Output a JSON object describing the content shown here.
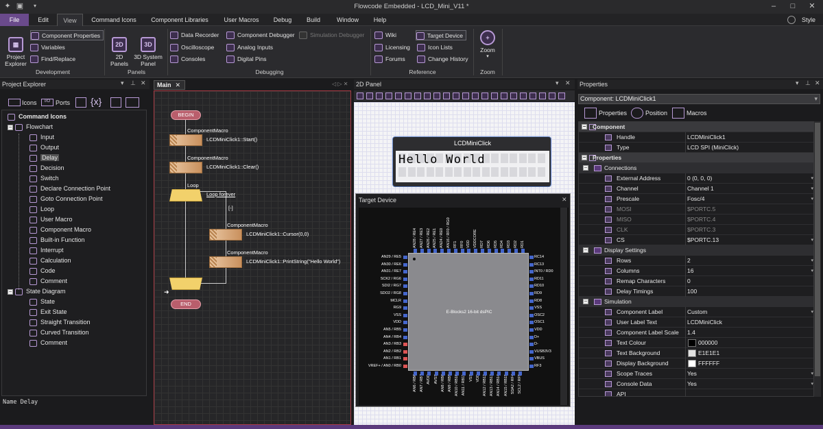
{
  "window": {
    "title": "Flowcode Embedded - LCD_Mini_V11 *",
    "style_label": "Style"
  },
  "menu": {
    "file": "File",
    "edit": "Edit",
    "view": "View",
    "command_icons": "Command Icons",
    "component_libraries": "Component Libraries",
    "user_macros": "User Macros",
    "debug": "Debug",
    "build": "Build",
    "window": "Window",
    "help": "Help"
  },
  "ribbon": {
    "project_explorer": "Project\nExplorer",
    "component_properties": "Component Properties",
    "variables": "Variables",
    "find_replace": "Find/Replace",
    "group_development": "Development",
    "panels_2d": "2D\nPanels",
    "system_panel_3d": "3D System\nPanel",
    "group_panels": "Panels",
    "data_recorder": "Data Recorder",
    "oscilloscope": "Oscilloscope",
    "consoles": "Consoles",
    "component_debugger": "Component Debugger",
    "analog_inputs": "Analog Inputs",
    "digital_pins": "Digital Pins",
    "simulation_debugger": "Simulation Debugger",
    "group_debugging": "Debugging",
    "wiki": "Wiki",
    "licensing": "Licensing",
    "forums": "Forums",
    "target_device": "Target Device",
    "icon_lists": "Icon Lists",
    "change_history": "Change History",
    "group_reference": "Reference",
    "zoom": "Zoom",
    "group_zoom": "Zoom"
  },
  "project_explorer": {
    "title": "Project Explorer",
    "tab_icons": "Icons",
    "tab_ports": "Ports",
    "status": "Name Delay",
    "items": [
      {
        "label": "Command Icons",
        "bold": true,
        "level": 0
      },
      {
        "label": "Flowchart",
        "level": 1,
        "exp": true
      },
      {
        "label": "Input",
        "level": 2
      },
      {
        "label": "Output",
        "level": 2
      },
      {
        "label": "Delay",
        "level": 2,
        "sel": true
      },
      {
        "label": "Decision",
        "level": 2
      },
      {
        "label": "Switch",
        "level": 2
      },
      {
        "label": "Declare Connection Point",
        "level": 2
      },
      {
        "label": "Goto Connection Point",
        "level": 2
      },
      {
        "label": "Loop",
        "level": 2
      },
      {
        "label": "User Macro",
        "level": 2
      },
      {
        "label": "Component Macro",
        "level": 2
      },
      {
        "label": "Built-in Function",
        "level": 2
      },
      {
        "label": "Interrupt",
        "level": 2
      },
      {
        "label": "Calculation",
        "level": 2
      },
      {
        "label": "Code",
        "level": 2
      },
      {
        "label": "Comment",
        "level": 2
      },
      {
        "label": "State Diagram",
        "level": 1,
        "exp": true
      },
      {
        "label": "State",
        "level": 2
      },
      {
        "label": "Exit State",
        "level": 2
      },
      {
        "label": "Straight Transition",
        "level": 2
      },
      {
        "label": "Curved Transition",
        "level": 2
      },
      {
        "label": "Comment",
        "level": 2
      }
    ]
  },
  "main": {
    "tab": "Main",
    "begin": "BEGIN",
    "end": "END",
    "loop_label": "Loop",
    "loop_text": "Loop forever",
    "collapse": "[-]",
    "macros": [
      {
        "head": "ComponentMacro",
        "call": "LCDMiniClick1::Start()"
      },
      {
        "head": "ComponentMacro",
        "call": "LCDMiniClick1::Clear()"
      },
      {
        "head": "ComponentMacro",
        "call": "LCDMiniClick1::Cursor(0,0)"
      },
      {
        "head": "ComponentMacro",
        "call": "LCDMiniClick1::PrintString(\"Hello World\")"
      }
    ]
  },
  "panel2d": {
    "title": "2D Panel",
    "lcd_title": "LCDMiniClick",
    "lcd_text": "Hello World"
  },
  "target": {
    "title": "Target Device",
    "chip_label": "E-Blocks2 16-bit dsPIC",
    "left_pins": [
      "AN29 / RE5",
      "AN30 / RE6",
      "AN31 / RE7",
      "SCK2 / RG6",
      "SDI2 / RG7",
      "SDO2 / RG8",
      "MCLR",
      "RG9",
      "VSS",
      "VDD",
      "AN5 / RB5",
      "AN4 / RB4",
      "AN3 / RB3",
      "AN2 / RB2",
      "AN1 / RB1",
      "VREF+ / AN0 / RB0"
    ],
    "right_pins": [
      "RC14",
      "RC13",
      "INT0 / RD0",
      "RD11",
      "RD10",
      "RD9",
      "RD8",
      "VSS",
      "OSC2",
      "OSC1",
      "VDD",
      "D+",
      "D-",
      "VUSB3V3",
      "VBUS",
      "RF3"
    ],
    "top_pins": [
      "AN28 / RE4",
      "AN27 / RE3",
      "AN26 / RE2",
      "AN25 / RE1",
      "AN24 / RE0",
      "AN16 / RF0 / RG0",
      "RF1",
      "RF0",
      "VDD",
      "VDDCORE",
      "RD7",
      "RD6",
      "RD5",
      "RD4",
      "RD3",
      "RD2",
      "RD1"
    ],
    "bottom_pins": [
      "AN6 / RB6",
      "AN7 / RB7",
      "AVDD",
      "AVSS",
      "AN8 / RB8",
      "AN9 / RB9",
      "AN10 / RB10",
      "AN11 / RB11",
      "VSS",
      "VDD",
      "AN12 / RB12",
      "AN13 / RB13",
      "AN14 / RB14",
      "AN15 / RB15",
      "SDA2 / RF4",
      "SCL2 / RF5"
    ]
  },
  "properties": {
    "title": "Properties",
    "component": "Component: LCDMiniClick1",
    "tab_properties": "Properties",
    "tab_position": "Position",
    "tab_macros": "Macros",
    "rows": [
      {
        "type": "cat",
        "name": "Component"
      },
      {
        "name": "Handle",
        "value": "LCDMiniClick1"
      },
      {
        "name": "Type",
        "value": "LCD SPI (MiniClick)"
      },
      {
        "type": "cat",
        "name": "Properties"
      },
      {
        "type": "sub",
        "name": "Connections"
      },
      {
        "name": "External Address",
        "value": "0 (0, 0, 0)",
        "dd": true
      },
      {
        "name": "Channel",
        "value": "Channel 1",
        "dd": true
      },
      {
        "name": "Prescale",
        "value": "Fosc/4",
        "dd": true
      },
      {
        "name": "MOSI",
        "value": "$PORTC.5",
        "dim": true
      },
      {
        "name": "MISO",
        "value": "$PORTC.4",
        "dim": true
      },
      {
        "name": "CLK",
        "value": "$PORTC.3",
        "dim": true
      },
      {
        "name": "CS",
        "value": "$PORTC.13",
        "dd": true
      },
      {
        "type": "sub",
        "name": "Display Settings"
      },
      {
        "name": "Rows",
        "value": "2",
        "dd": true
      },
      {
        "name": "Columns",
        "value": "16",
        "dd": true
      },
      {
        "name": "Remap Characters",
        "value": "0"
      },
      {
        "name": "Delay Timings",
        "value": "100"
      },
      {
        "type": "sub",
        "name": "Simulation"
      },
      {
        "name": "Component Label",
        "value": "Custom",
        "dd": true
      },
      {
        "name": "User Label Text",
        "value": "LCDMiniClick"
      },
      {
        "name": "Component Label Scale",
        "value": "1.4"
      },
      {
        "name": "Text Colour",
        "value": "000000",
        "swatch": "#000000"
      },
      {
        "name": "Text Background",
        "value": "E1E1E1",
        "swatch": "#E1E1E1"
      },
      {
        "name": "Display Background",
        "value": "FFFFFF",
        "swatch": "#FFFFFF"
      },
      {
        "name": "Scope Traces",
        "value": "Yes",
        "dd": true
      },
      {
        "name": "Console Data",
        "value": "Yes",
        "dd": true
      },
      {
        "name": "API",
        "value": ""
      }
    ]
  },
  "colors": {
    "accent": "#6a4a8c",
    "macro_block": "#d9a878",
    "loop_block": "#f2d16b",
    "terminator": "#b95e6c"
  }
}
